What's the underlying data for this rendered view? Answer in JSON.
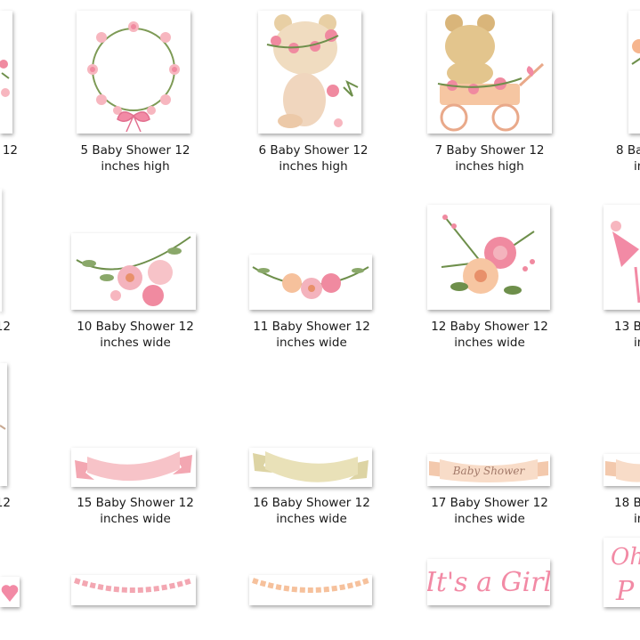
{
  "files": [
    {
      "id": "f4",
      "line1": "12",
      "line2": ""
    },
    {
      "id": "f5",
      "line1": "5 Baby Shower 12",
      "line2": "inches high"
    },
    {
      "id": "f6",
      "line1": "6 Baby Shower 12",
      "line2": "inches high"
    },
    {
      "id": "f7",
      "line1": "7 Baby Shower 12",
      "line2": "inches high"
    },
    {
      "id": "f8",
      "line1": "8 Ba",
      "line2": "in"
    },
    {
      "id": "f9",
      "line1": "12",
      "line2": ""
    },
    {
      "id": "f10",
      "line1": "10 Baby Shower 12",
      "line2": "inches wide"
    },
    {
      "id": "f11",
      "line1": "11 Baby Shower 12",
      "line2": "inches wide"
    },
    {
      "id": "f12",
      "line1": "12 Baby Shower 12",
      "line2": "inches wide"
    },
    {
      "id": "f13",
      "line1": "13 Ba",
      "line2": "in"
    },
    {
      "id": "f14",
      "line1": "12",
      "line2": ""
    },
    {
      "id": "f15",
      "line1": "15 Baby Shower 12",
      "line2": "inches wide"
    },
    {
      "id": "f16",
      "line1": "16 Baby Shower 12",
      "line2": "inches wide"
    },
    {
      "id": "f17",
      "line1": "17 Baby Shower 12",
      "line2": "inches wide"
    },
    {
      "id": "f18",
      "line1": "18 Ba",
      "line2": "in"
    }
  ],
  "thumb_text": {
    "banner_script": "Baby Shower",
    "girl_script": "It's a Girl",
    "partial_o": "Oh",
    "partial_p": "P"
  },
  "colors": {
    "pink": "#f08aa0",
    "light_pink": "#f7c3c8",
    "peach": "#f6c6a2",
    "cream": "#e9e1b8",
    "leaf": "#6e8f4b",
    "bear": "#e3c58d"
  }
}
